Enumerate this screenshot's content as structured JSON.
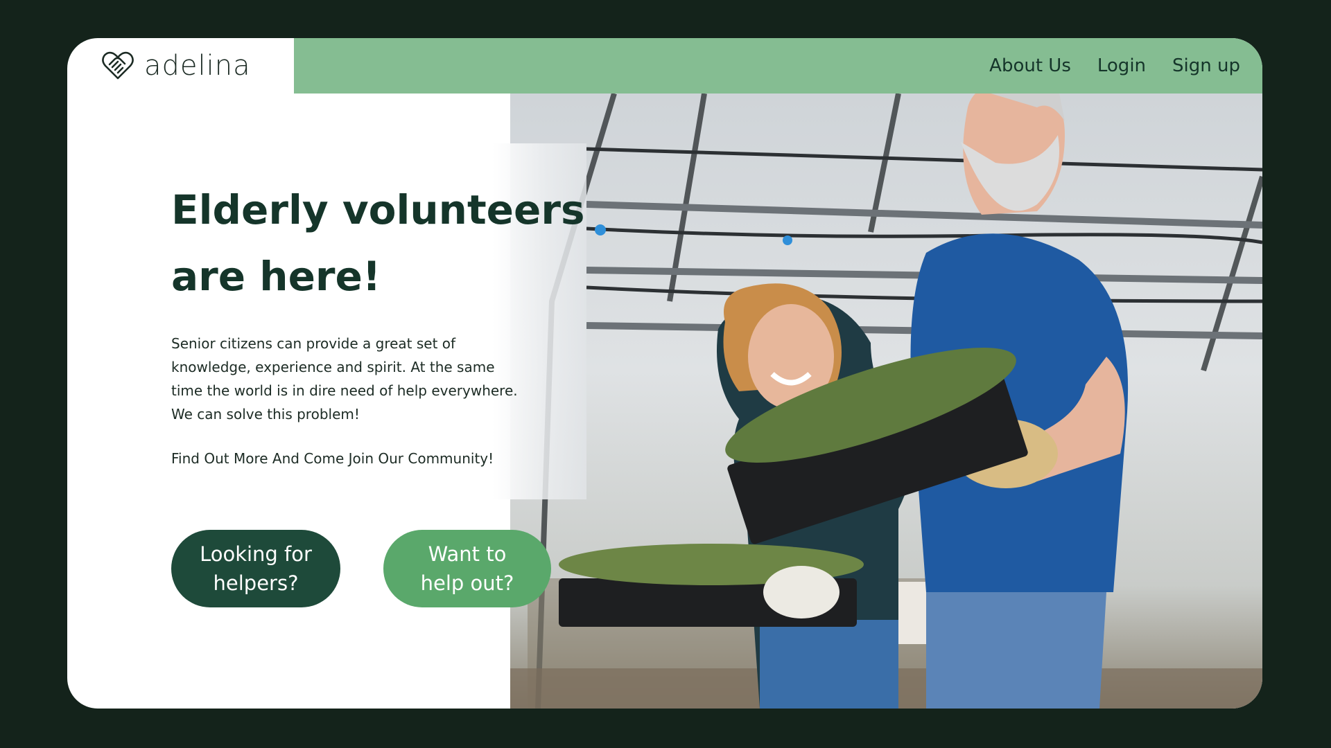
{
  "brand": {
    "name": "adelina",
    "logo_icon": "heart-handshake-icon"
  },
  "nav": {
    "items": [
      {
        "label": "About Us"
      },
      {
        "label": "Login"
      },
      {
        "label": "Sign up"
      }
    ]
  },
  "hero": {
    "title_line1": "Elderly volunteers",
    "title_line2": "are here!",
    "body_lines": [
      "Senior citizens can provide a great set of",
      "knowledge, experience and spirit. At the same",
      "time the world is in dire need of help everywhere.",
      "We can solve this problem!"
    ],
    "cta_text": "Find Out More And Come Join Our Community!",
    "buttons": {
      "helpers": {
        "line1": "Looking for",
        "line2": "helpers?"
      },
      "helpout": {
        "line1": "Want to",
        "line2": "help out?"
      }
    }
  },
  "colors": {
    "page_background": "#14231b",
    "nav_background": "#85bd92",
    "primary_dark": "#1e4a3a",
    "primary_light": "#5aa86b",
    "heading_text": "#15352a"
  }
}
